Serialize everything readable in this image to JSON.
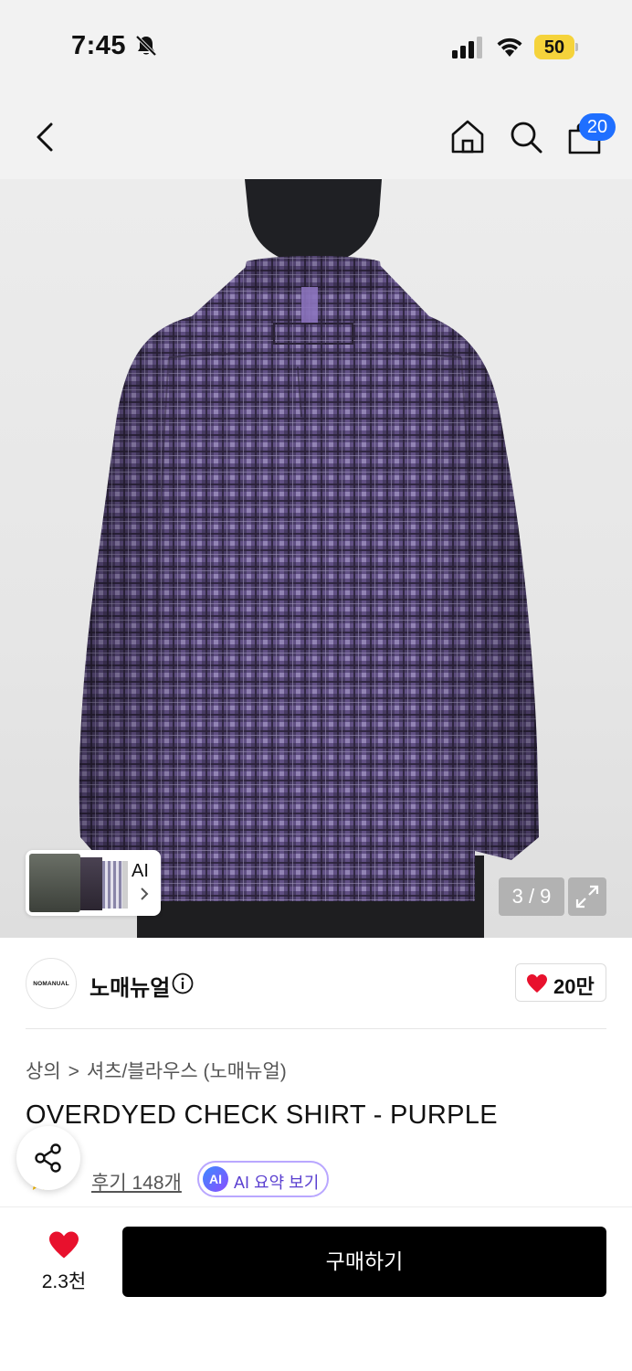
{
  "status_bar": {
    "time": "7:45",
    "battery": "50"
  },
  "nav": {
    "cart_count": "20"
  },
  "gallery": {
    "ai_label": "AI",
    "page_counter": "3 / 9"
  },
  "brand": {
    "logo_text": "NOMANUAL",
    "name": "노매뉴얼",
    "like_count": "20만"
  },
  "breadcrumb": {
    "category": "상의",
    "separator": ">",
    "subcategory": "셔츠/블라우스 (노매뉴얼)"
  },
  "product": {
    "title": "OVERDYED CHECK SHIRT - PURPLE",
    "rating": ".9",
    "review_link": "후기 148개",
    "ai_badge": "AI",
    "ai_summary_label": "AI 요약 보기"
  },
  "bottom_bar": {
    "wish_count": "2.3천",
    "buy_label": "구매하기"
  },
  "colors": {
    "accent_blue": "#1f6fff",
    "heart_red": "#e8112d",
    "shirt_purple": "#4a3d66",
    "buy_button": "#000000"
  }
}
